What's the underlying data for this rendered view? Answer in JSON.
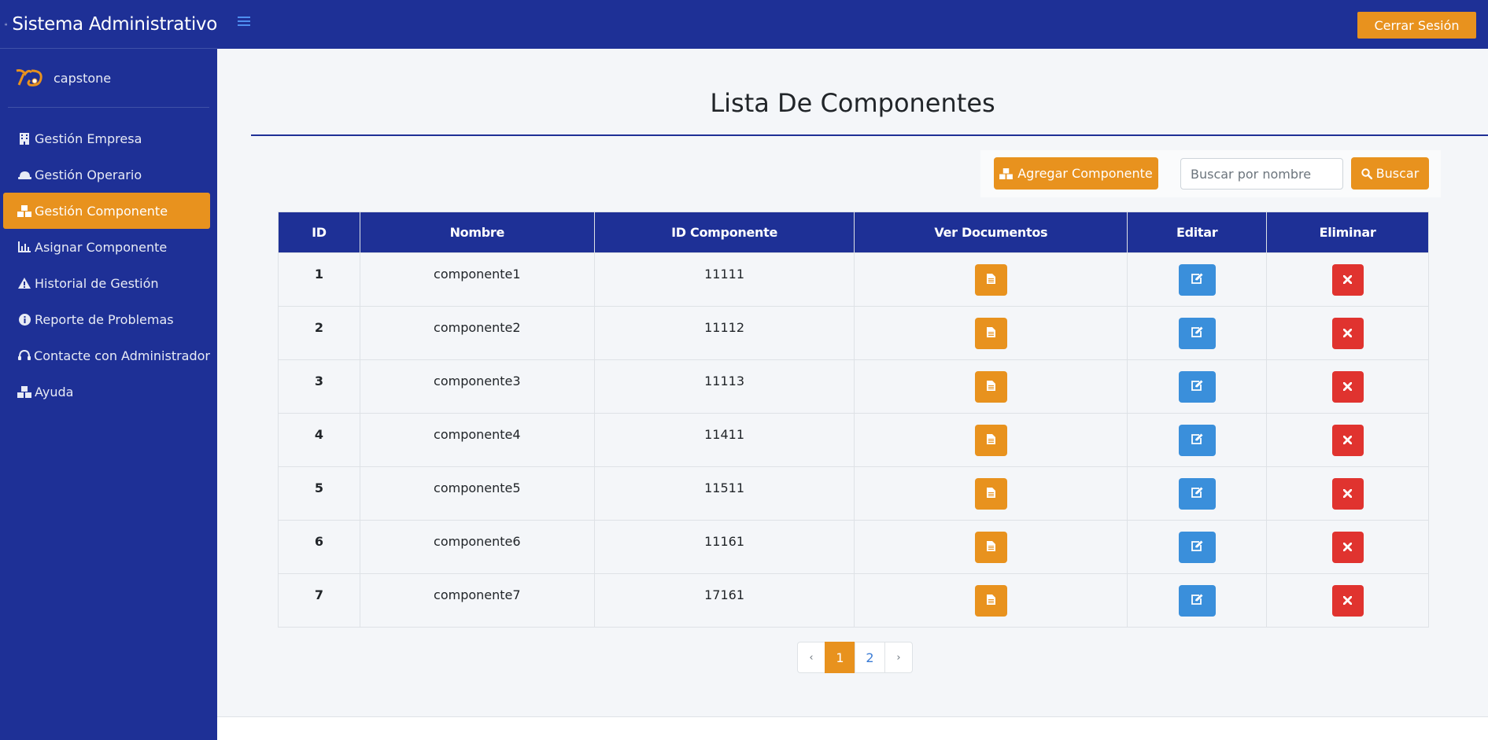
{
  "app": {
    "title": "Sistema Administrativo"
  },
  "user": {
    "name": "capstone"
  },
  "header": {
    "logout_label": "Cerrar Sesión"
  },
  "sidebar": {
    "items": [
      {
        "label": "Gestión Empresa",
        "icon": "building-icon"
      },
      {
        "label": "Gestión Operario",
        "icon": "hard-hat-icon"
      },
      {
        "label": "Gestión Componente",
        "icon": "boxes-icon",
        "active": true
      },
      {
        "label": "Asignar Componente",
        "icon": "bar-chart-icon"
      },
      {
        "label": "Historial de Gestión",
        "icon": "warning-icon"
      },
      {
        "label": "Reporte de Problemas",
        "icon": "info-icon"
      },
      {
        "label": "Contacte con Administrador",
        "icon": "headset-icon"
      },
      {
        "label": "Ayuda",
        "icon": "boxes-icon"
      }
    ]
  },
  "main": {
    "title": "Lista De Componentes",
    "add_label": "Agregar Componente",
    "search_placeholder": "Buscar por nombre",
    "search_label": "Buscar",
    "table": {
      "headers": [
        "ID",
        "Nombre",
        "ID Componente",
        "Ver Documentos",
        "Editar",
        "Eliminar"
      ],
      "rows": [
        {
          "id": "1",
          "nombre": "componente1",
          "id_componente": "11111"
        },
        {
          "id": "2",
          "nombre": "componente2",
          "id_componente": "11112"
        },
        {
          "id": "3",
          "nombre": "componente3",
          "id_componente": "11113"
        },
        {
          "id": "4",
          "nombre": "componente4",
          "id_componente": "11411"
        },
        {
          "id": "5",
          "nombre": "componente5",
          "id_componente": "11511"
        },
        {
          "id": "6",
          "nombre": "componente6",
          "id_componente": "11161"
        },
        {
          "id": "7",
          "nombre": "componente7",
          "id_componente": "17161"
        }
      ]
    },
    "pagination": {
      "prev": "‹",
      "pages": [
        "1",
        "2"
      ],
      "current": "1",
      "next": "›"
    }
  },
  "colors": {
    "primary": "#1e3096",
    "accent": "#e8921e",
    "edit": "#3a8fdb",
    "danger": "#e0332f"
  }
}
